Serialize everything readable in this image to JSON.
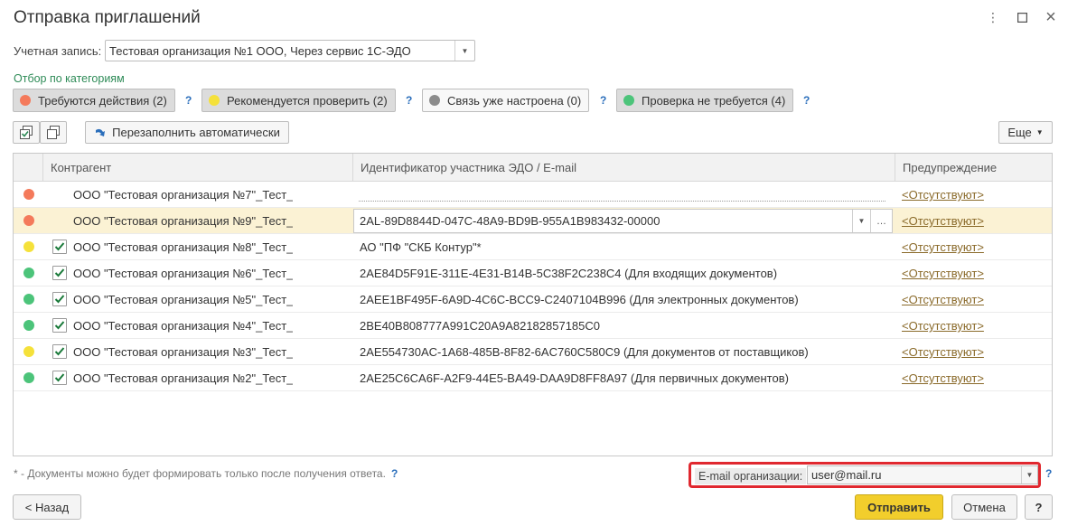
{
  "window": {
    "title": "Отправка приглашений"
  },
  "account": {
    "label": "Учетная запись:",
    "value": "Тестовая организация №1 ООО, Через сервис 1С-ЭДО"
  },
  "filter": {
    "label": "Отбор по категориям",
    "categories": [
      {
        "label": "Требуются действия (2)",
        "color": "#f47a5b",
        "active": true
      },
      {
        "label": "Рекомендуется проверить (2)",
        "color": "#f5e13a",
        "active": true
      },
      {
        "label": "Связь уже настроена (0)",
        "color": "#8c8c8c",
        "active": false
      },
      {
        "label": "Проверка не требуется (4)",
        "color": "#4cc47a",
        "active": true
      }
    ],
    "help": "?"
  },
  "toolbar": {
    "refill_label": "Перезаполнить автоматически",
    "more_label": "Еще"
  },
  "table": {
    "columns": {
      "counterparty": "Контрагент",
      "id": "Идентификатор участника ЭДО / E-mail",
      "warning": "Предупреждение"
    },
    "rows": [
      {
        "status": "#f47a5b",
        "checked": false,
        "name": "ООО \"Тестовая организация №7\"_Тест_",
        "id": "",
        "warning": "<Отсутствуют>"
      },
      {
        "status": "#f47a5b",
        "checked": false,
        "name": "ООО \"Тестовая организация №9\"_Тест_",
        "id": "2AL-89D8844D-047C-48A9-BD9B-955A1B983432-00000",
        "warning": "<Отсутствуют>",
        "selected": true
      },
      {
        "status": "#f5e13a",
        "checked": true,
        "name": "ООО \"Тестовая организация №8\"_Тест_",
        "id": "АО \"ПФ \"СКБ Контур\"*",
        "warning": "<Отсутствуют>"
      },
      {
        "status": "#4cc47a",
        "checked": true,
        "name": "ООО \"Тестовая организация №6\"_Тест_",
        "id": "2AE84D5F91E-311E-4E31-B14B-5C38F2C238C4 (Для входящих документов)",
        "warning": "<Отсутствуют>"
      },
      {
        "status": "#4cc47a",
        "checked": true,
        "name": "ООО \"Тестовая организация №5\"_Тест_",
        "id": "2AEE1BF495F-6A9D-4C6C-BCC9-C2407104B996 (Для электронных документов)",
        "warning": "<Отсутствуют>"
      },
      {
        "status": "#4cc47a",
        "checked": true,
        "name": "ООО \"Тестовая организация №4\"_Тест_",
        "id": "2BE40B808777A991C20A9A82182857185C0",
        "warning": "<Отсутствуют>"
      },
      {
        "status": "#f5e13a",
        "checked": true,
        "name": "ООО \"Тестовая организация №3\"_Тест_",
        "id": "2AE554730AC-1A68-485B-8F82-6AC760C580C9 (Для документов от поставщиков)",
        "warning": "<Отсутствуют>"
      },
      {
        "status": "#4cc47a",
        "checked": true,
        "name": "ООО \"Тестовая организация №2\"_Тест_",
        "id": "2AE25C6CA6F-A2F9-44E5-BA49-DAA9D8FF8A97 (Для первичных документов)",
        "warning": "<Отсутствуют>"
      }
    ]
  },
  "footer": {
    "note": "* - Документы можно будет формировать только после получения ответа.",
    "email_label": "E-mail организации:",
    "email_value": "user@mail.ru",
    "help": "?",
    "back_label": "< Назад",
    "send_label": "Отправить",
    "cancel_label": "Отмена"
  }
}
